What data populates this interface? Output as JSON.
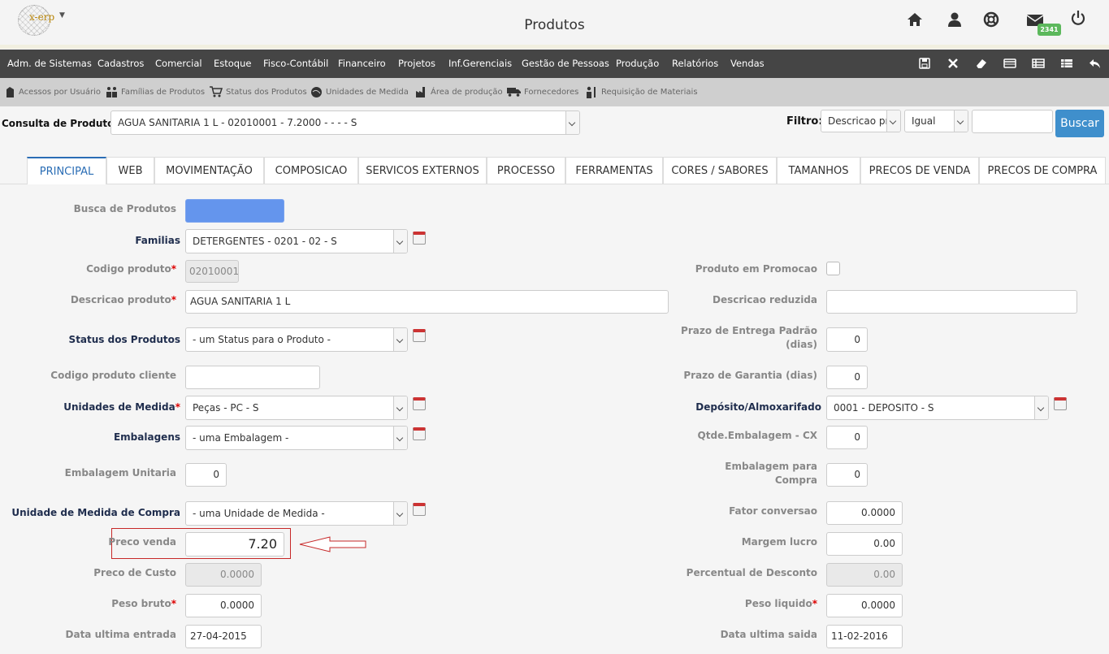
{
  "header": {
    "logo_text": "x-erp",
    "title": "Produtos",
    "mail_badge": "2341",
    "icons": [
      "home-icon",
      "user-icon",
      "help-lifebuoy-icon",
      "mail-icon",
      "power-icon"
    ]
  },
  "menu": {
    "items": [
      "Adm. de Sistemas",
      "Cadastros",
      "Comercial",
      "Estoque",
      "Fisco-Contábil",
      "Financeiro",
      "Projetos",
      "Inf.Gerenciais",
      "Gestão de Pessoas",
      "Produção",
      "Relatórios",
      "Vendas"
    ],
    "toolbar_icons": [
      "save-icon",
      "close-icon",
      "eraser-icon",
      "card-icon",
      "list-icon",
      "table-list-icon",
      "undo-icon"
    ]
  },
  "quickbar": {
    "items": [
      "Acessos por Usuário",
      "Famílias de Produtos",
      "Status dos Produtos",
      "Unidades de Medida",
      "Área de produção",
      "Fornecedores",
      "Requisição de Materiais"
    ]
  },
  "consulta": {
    "label": "Consulta de Produtos",
    "value": "AGUA SANITARIA 1 L - 02010001 - 7.2000 - - - - S",
    "filtro_label": "Filtro:",
    "filtro_campo": "Descricao pr",
    "filtro_operador": "Igual",
    "filtro_valor": "",
    "buscar": "Buscar"
  },
  "tabs": [
    "PRINCIPAL",
    "WEB",
    "MOVIMENTAÇÃO",
    "COMPOSICAO",
    "SERVICOS EXTERNOS",
    "PROCESSO",
    "FERRAMENTAS",
    "CORES / SABORES",
    "TAMANHOS",
    "PRECOS DE VENDA",
    "PRECOS DE COMPRA"
  ],
  "form": {
    "busca_produtos": "Busca de Produtos",
    "familias": {
      "label": "Familias",
      "value": "DETERGENTES - 0201 - 02 - S"
    },
    "codigo_produto": {
      "label": "Codigo produto",
      "value": "02010001"
    },
    "descricao_produto": {
      "label": "Descricao produto",
      "value": "AGUA SANITARIA 1 L"
    },
    "status_produtos": {
      "label": "Status dos Produtos",
      "value": "- um Status para o Produto -"
    },
    "codigo_cliente": {
      "label": "Codigo produto cliente",
      "value": ""
    },
    "unidades_medida": {
      "label": "Unidades de Medida",
      "value": "Peças - PC - S"
    },
    "embalagens": {
      "label": "Embalagens",
      "value": "- uma Embalagem -"
    },
    "embalagem_unitaria": {
      "label": "Embalagem Unitaria",
      "value": "0"
    },
    "unidade_compra": {
      "label": "Unidade de Medida de Compra",
      "value": "- uma Unidade de Medida -"
    },
    "preco_venda": {
      "label": "Preco venda",
      "value": "7.20"
    },
    "preco_custo": {
      "label": "Preco de Custo",
      "value": "0.0000"
    },
    "peso_bruto": {
      "label": "Peso bruto",
      "value": "0.0000"
    },
    "data_ultima_entrada": {
      "label": "Data ultima entrada",
      "value": "27-04-2015"
    },
    "produto_promocao": {
      "label": "Produto em Promocao",
      "checked": false
    },
    "descricao_reduzida": {
      "label": "Descricao reduzida",
      "value": ""
    },
    "prazo_entrega": {
      "label_1": "Prazo de Entrega Padrão",
      "label_2": "(dias)",
      "value": "0"
    },
    "prazo_garantia": {
      "label": "Prazo de Garantia (dias)",
      "value": "0"
    },
    "deposito": {
      "label": "Depósito/Almoxarifado",
      "value": "0001 - DEPOSITO - S"
    },
    "qtde_embalagem": {
      "label": "Qtde.Embalagem - CX",
      "value": "0"
    },
    "embalagem_compra": {
      "label_1": "Embalagem para",
      "label_2": "Compra",
      "value": "0"
    },
    "fator_conversao": {
      "label": "Fator conversao",
      "value": "0.0000"
    },
    "margem_lucro": {
      "label": "Margem lucro",
      "value": "0.00"
    },
    "percentual_desconto": {
      "label": "Percentual de Desconto",
      "value": "0.00"
    },
    "peso_liquido": {
      "label": "Peso liquido",
      "value": "0.0000"
    },
    "data_ultima_saida": {
      "label": "Data ultima saida",
      "value": "11-02-2016"
    }
  },
  "colors": {
    "menu_bg": "#454545",
    "accent": "#2a6db5",
    "busca_button": "#6495ed",
    "buscar_button": "#3f8fcc",
    "highlight_border": "#c62828",
    "badge": "#5cb85c"
  }
}
